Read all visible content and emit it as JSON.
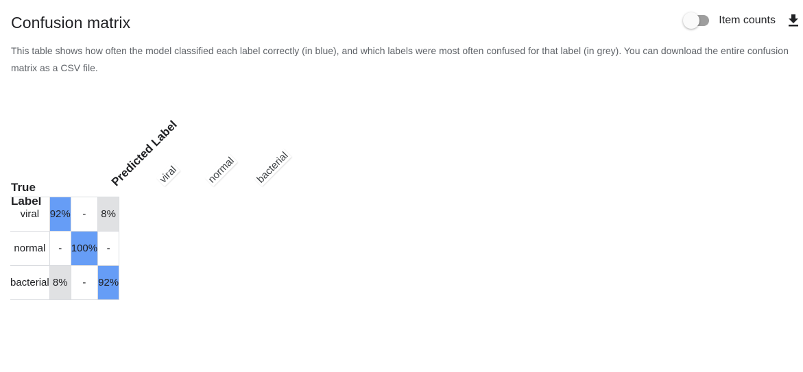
{
  "header": {
    "title": "Confusion matrix",
    "toggle_label": "Item counts",
    "toggle_on": false,
    "download_icon": "download-icon"
  },
  "description": "This table shows how often the model classified each label correctly (in blue), and which labels were most often confused for that label (in grey). You can download the entire confusion matrix as a CSV file.",
  "matrix": {
    "row_axis_label": "True Label",
    "col_axis_label": "Predicted Label",
    "columns": [
      "viral",
      "normal",
      "bacterial"
    ],
    "rows": [
      {
        "label": "viral",
        "cells": [
          {
            "text": "92%",
            "kind": "correct"
          },
          {
            "text": "-",
            "kind": "empty"
          },
          {
            "text": "8%",
            "kind": "confused"
          }
        ]
      },
      {
        "label": "normal",
        "cells": [
          {
            "text": "-",
            "kind": "empty"
          },
          {
            "text": "100%",
            "kind": "correct"
          },
          {
            "text": "-",
            "kind": "empty"
          }
        ]
      },
      {
        "label": "bacterial",
        "cells": [
          {
            "text": "8%",
            "kind": "confused"
          },
          {
            "text": "-",
            "kind": "empty"
          },
          {
            "text": "92%",
            "kind": "correct"
          }
        ]
      }
    ],
    "colors": {
      "correct": "#669df6",
      "confused": "#e0e1e3",
      "empty": "#ffffff"
    }
  }
}
